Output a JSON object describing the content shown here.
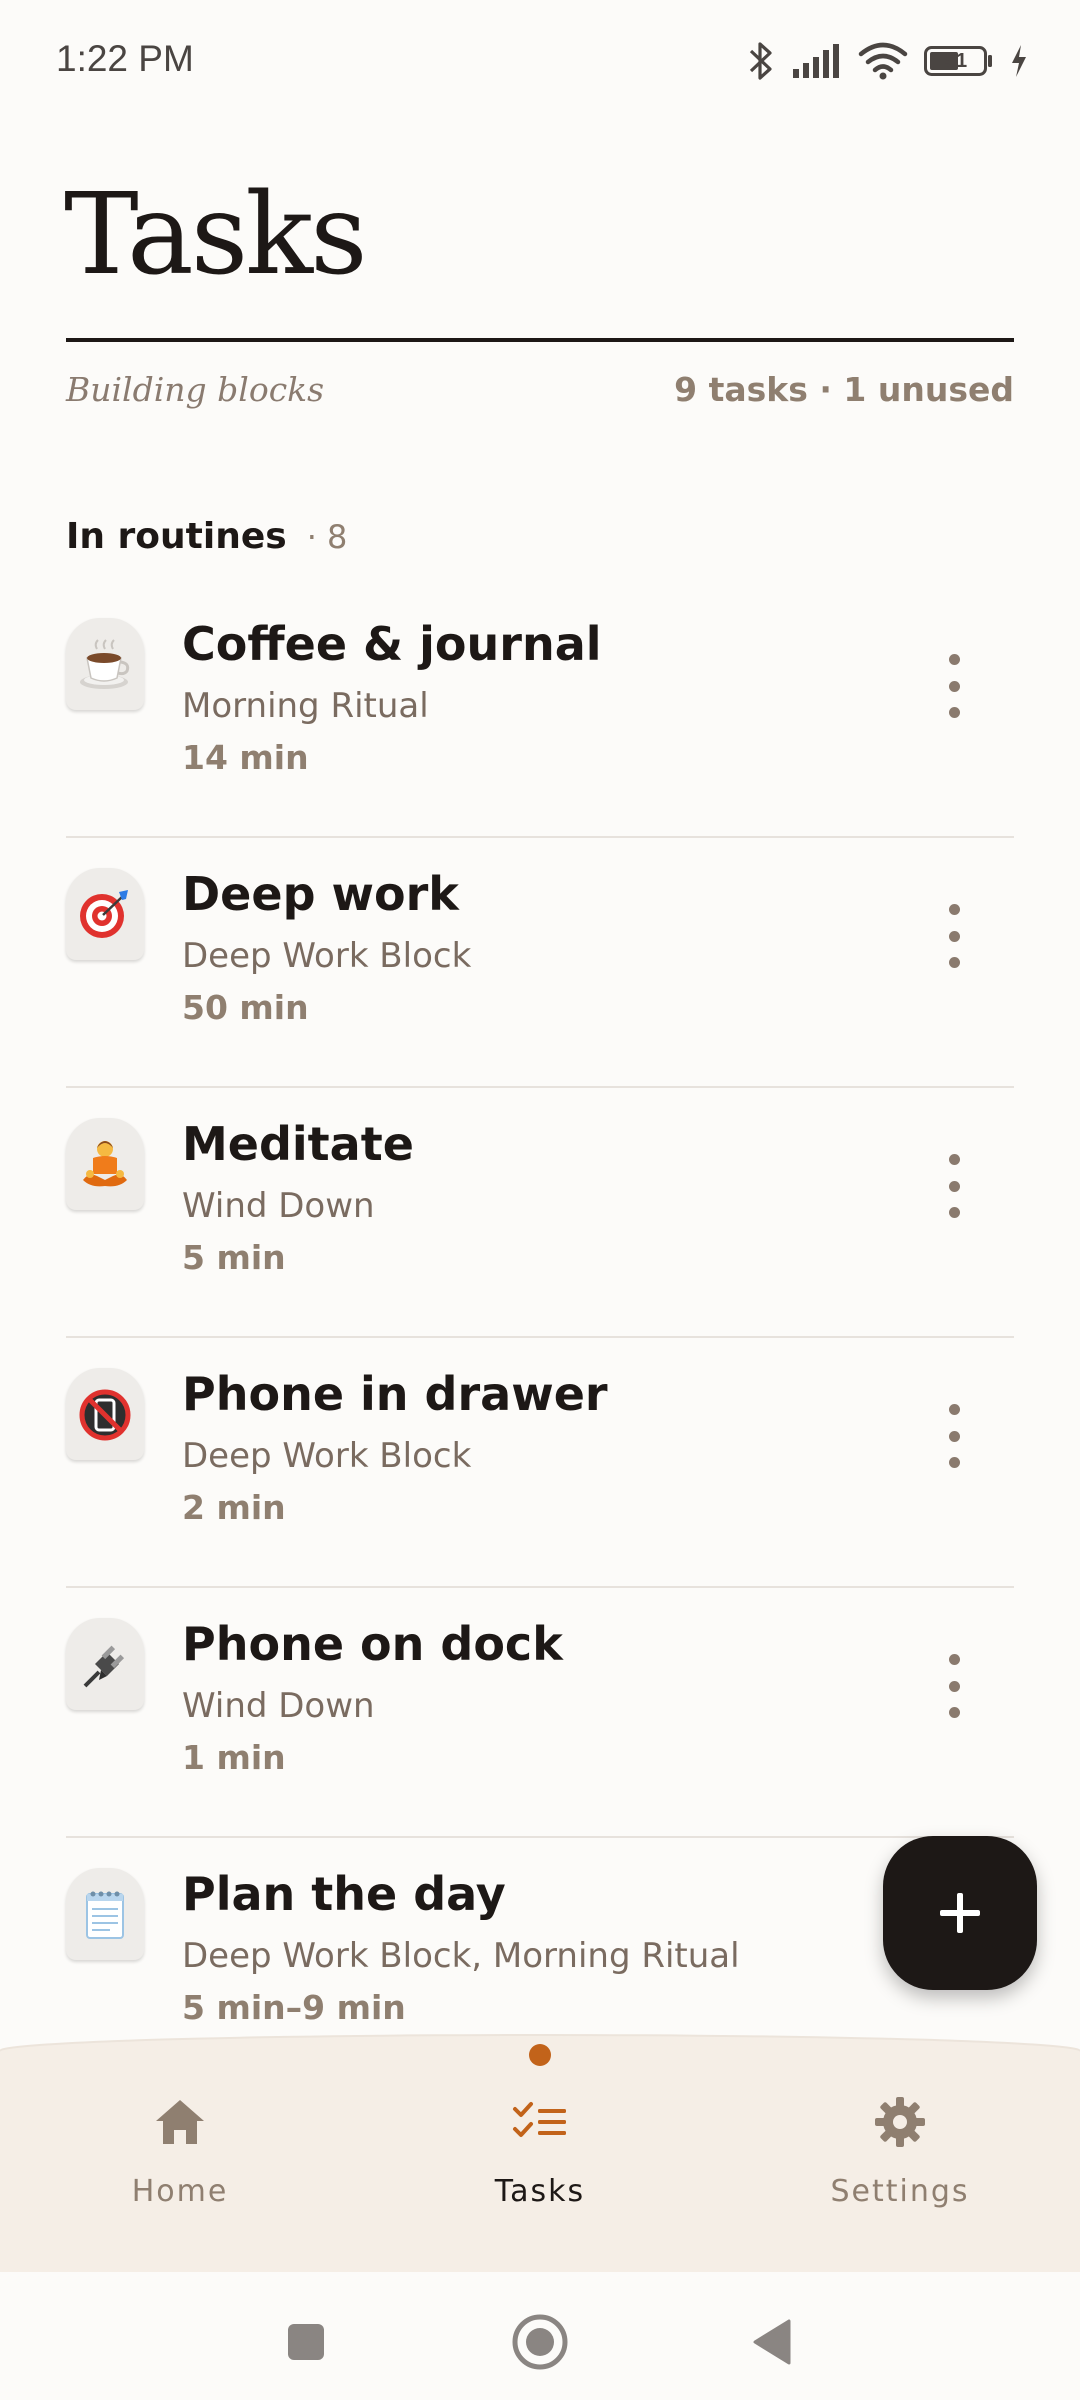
{
  "status_bar": {
    "time": "1:22 PM",
    "battery_level": "51"
  },
  "header": {
    "title": "Tasks",
    "subtitle": "Building blocks",
    "summary": "9 tasks · 1 unused"
  },
  "section": {
    "title": "In routines",
    "count": "· 8"
  },
  "tasks": [
    {
      "name": "Coffee & journal",
      "routine": "Morning Ritual",
      "duration": "14 min",
      "icon": "coffee-icon"
    },
    {
      "name": "Deep work",
      "routine": "Deep Work Block",
      "duration": "50 min",
      "icon": "target-icon"
    },
    {
      "name": "Meditate",
      "routine": "Wind Down",
      "duration": "5 min",
      "icon": "meditation-icon"
    },
    {
      "name": "Phone in drawer",
      "routine": "Deep Work Block",
      "duration": "2 min",
      "icon": "no-phone-icon"
    },
    {
      "name": "Phone on dock",
      "routine": "Wind Down",
      "duration": "1 min",
      "icon": "plug-icon"
    },
    {
      "name": "Plan the day",
      "routine": "Deep Work Block, Morning Ritual",
      "duration": "5 min–9 min",
      "icon": "notepad-icon"
    }
  ],
  "nav": {
    "home": "Home",
    "tasks": "Tasks",
    "settings": "Settings",
    "active": "tasks"
  },
  "colors": {
    "background": "#FCFBF9",
    "text": "#1D1816",
    "muted": "#8F7F70",
    "accent": "#C2631A",
    "nav_background": "#F5EEE6"
  }
}
